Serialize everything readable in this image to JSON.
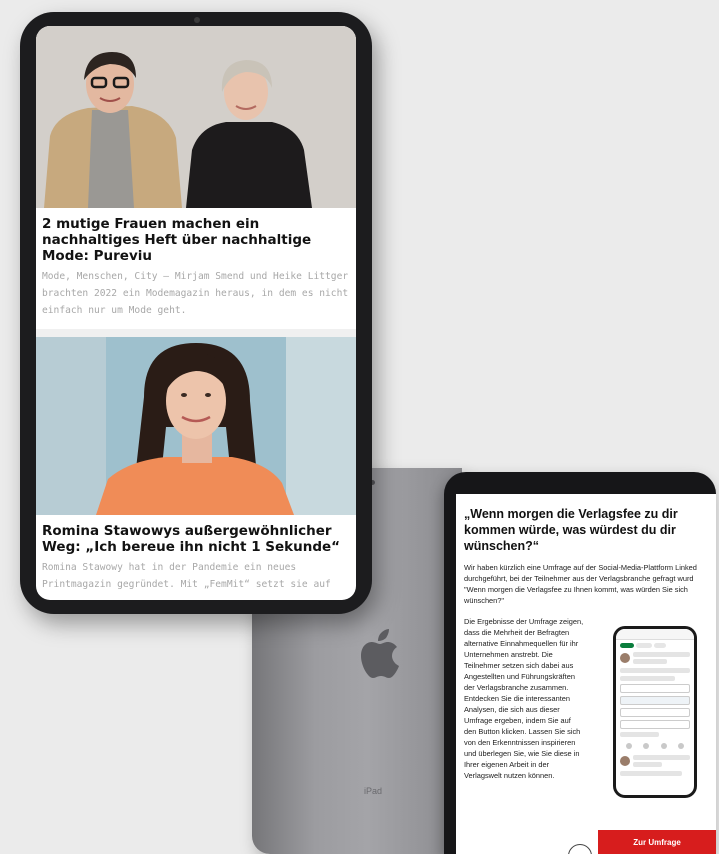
{
  "front_tablet": {
    "articles": [
      {
        "title": "2 mutige Frauen machen ein nachhaltiges Heft über nachhaltige Mode: Pureviu",
        "text": "Mode, Menschen, City – Mirjam Smend und Heike Littger brachten 2022 ein Modemagazin heraus, in dem es nicht einfach nur um Mode geht."
      },
      {
        "title": "Romina Stawowys außergewöhnlicher Weg: „Ich bereue ihn nicht 1 Sekunde“",
        "text": "Romina Stawowy hat in der Pandemie ein neues Printmagazin gegründet. Mit „FemMit“ setzt sie auf"
      }
    ]
  },
  "back_tablet": {
    "label": "iPad"
  },
  "right_tablet": {
    "headline": "„Wenn morgen die Verlagsfee zu dir kommen würde, was würdest du dir wünschen?“",
    "intro_lines": [
      "Wir haben kürzlich eine Umfrage auf der Social-Media-Plattform Linked",
      "durchgeführt, bei der Teilnehmer aus der Verlagsbranche gefragt wurd",
      "\"Wenn morgen die Verlagsfee zu Ihnen kommt, was würden Sie sich",
      "wünschen?\""
    ],
    "body_lines": [
      "Die Ergebnisse der Umfrage zeigen,",
      "dass die Mehrheit der Befragten",
      "alternative Einnahmequellen für ihr",
      "Unternehmen anstrebt. Die",
      "Teilnehmer setzen sich dabei aus",
      "Angestellten und Führungskräften",
      "der Verlagsbranche zusammen.",
      "Entdecken Sie die interessanten",
      "Analysen, die sich aus dieser",
      "Umfrage ergeben, indem Sie auf",
      "den Button klicken. Lassen Sie sich",
      "von den Erkenntnissen inspirieren",
      "und überlegen Sie, wie Sie diese in",
      "Ihrer eigenen Arbeit in der",
      "Verlagswelt nutzen können."
    ],
    "cta_label": "Zur Umfrage"
  }
}
